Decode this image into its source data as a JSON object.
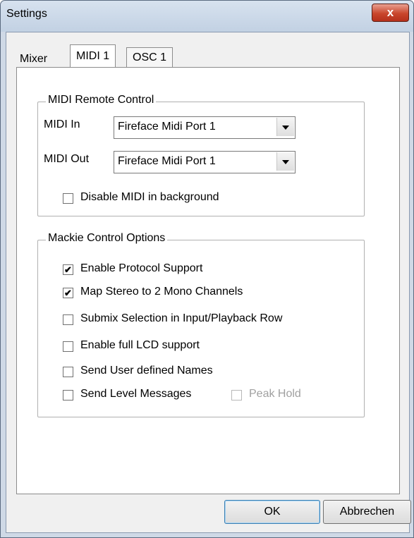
{
  "window": {
    "title": "Settings",
    "close_label": "x"
  },
  "tabs": [
    {
      "label": "Mixer",
      "selected": false
    },
    {
      "label": "MIDI 1",
      "selected": true
    },
    {
      "label": "OSC 1",
      "selected": false
    }
  ],
  "midi_remote": {
    "group_label": "MIDI Remote Control",
    "midi_in_label": "MIDI In",
    "midi_in_value": "Fireface Midi Port 1",
    "midi_out_label": "MIDI Out",
    "midi_out_value": "Fireface Midi Port 1",
    "disable_bg_label": "Disable MIDI in background",
    "disable_bg_checked": false
  },
  "mackie": {
    "group_label": "Mackie Control Options",
    "options": [
      {
        "label": "Enable Protocol Support",
        "checked": true
      },
      {
        "label": "Map Stereo to 2 Mono Channels",
        "checked": true
      },
      {
        "label": "Submix Selection in Input/Playback Row",
        "checked": false
      },
      {
        "label": "Enable full LCD support",
        "checked": false
      },
      {
        "label": "Send User defined Names",
        "checked": false
      },
      {
        "label": "Send Level Messages",
        "checked": false
      }
    ],
    "peak_hold_label": "Peak Hold",
    "peak_hold_checked": false,
    "peak_hold_enabled": false
  },
  "buttons": {
    "ok_label": "OK",
    "cancel_label": "Abbrechen"
  }
}
